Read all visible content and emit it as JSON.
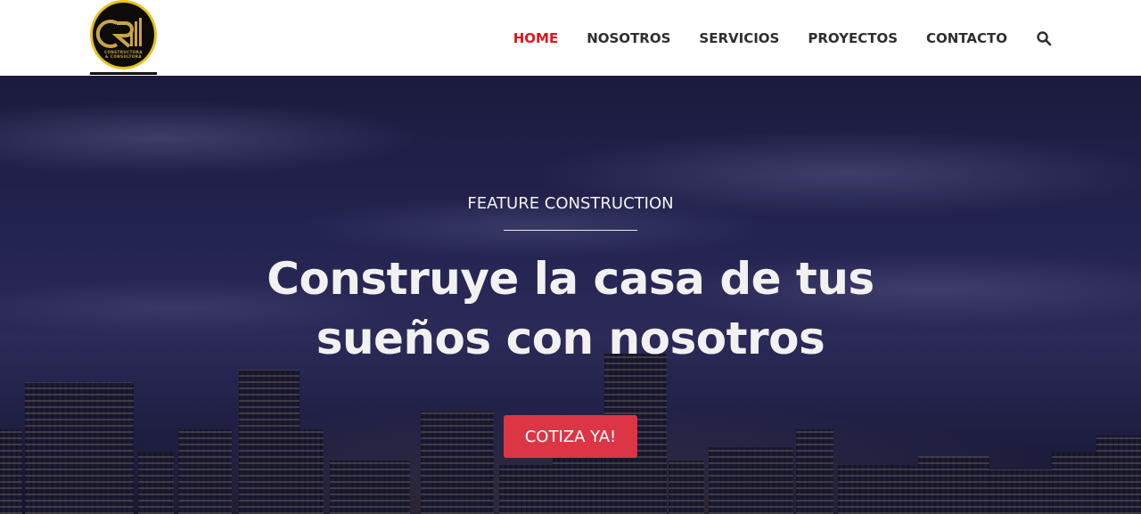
{
  "header": {
    "logo": {
      "line1": "CONSTRUCTORA",
      "line2": "& CONSULTORA",
      "colors": {
        "ring": "#e6c21c",
        "gold": "#c9a34a",
        "background": "#0d0c0a"
      }
    },
    "nav": [
      {
        "label": "HOME",
        "active": true
      },
      {
        "label": "NOSOTROS",
        "active": false
      },
      {
        "label": "SERVICIOS",
        "active": false
      },
      {
        "label": "PROYECTOS",
        "active": false
      },
      {
        "label": "CONTACTO",
        "active": false
      }
    ],
    "search_icon": "search-icon",
    "active_color": "#e3141c"
  },
  "hero": {
    "eyebrow": "FEATURE CONSTRUCTION",
    "headline_line1": "Construye la casa de tus",
    "headline_line2": "sueños con nosotros",
    "cta_label": "COTIZA YA!",
    "cta_color": "#dc3545"
  }
}
